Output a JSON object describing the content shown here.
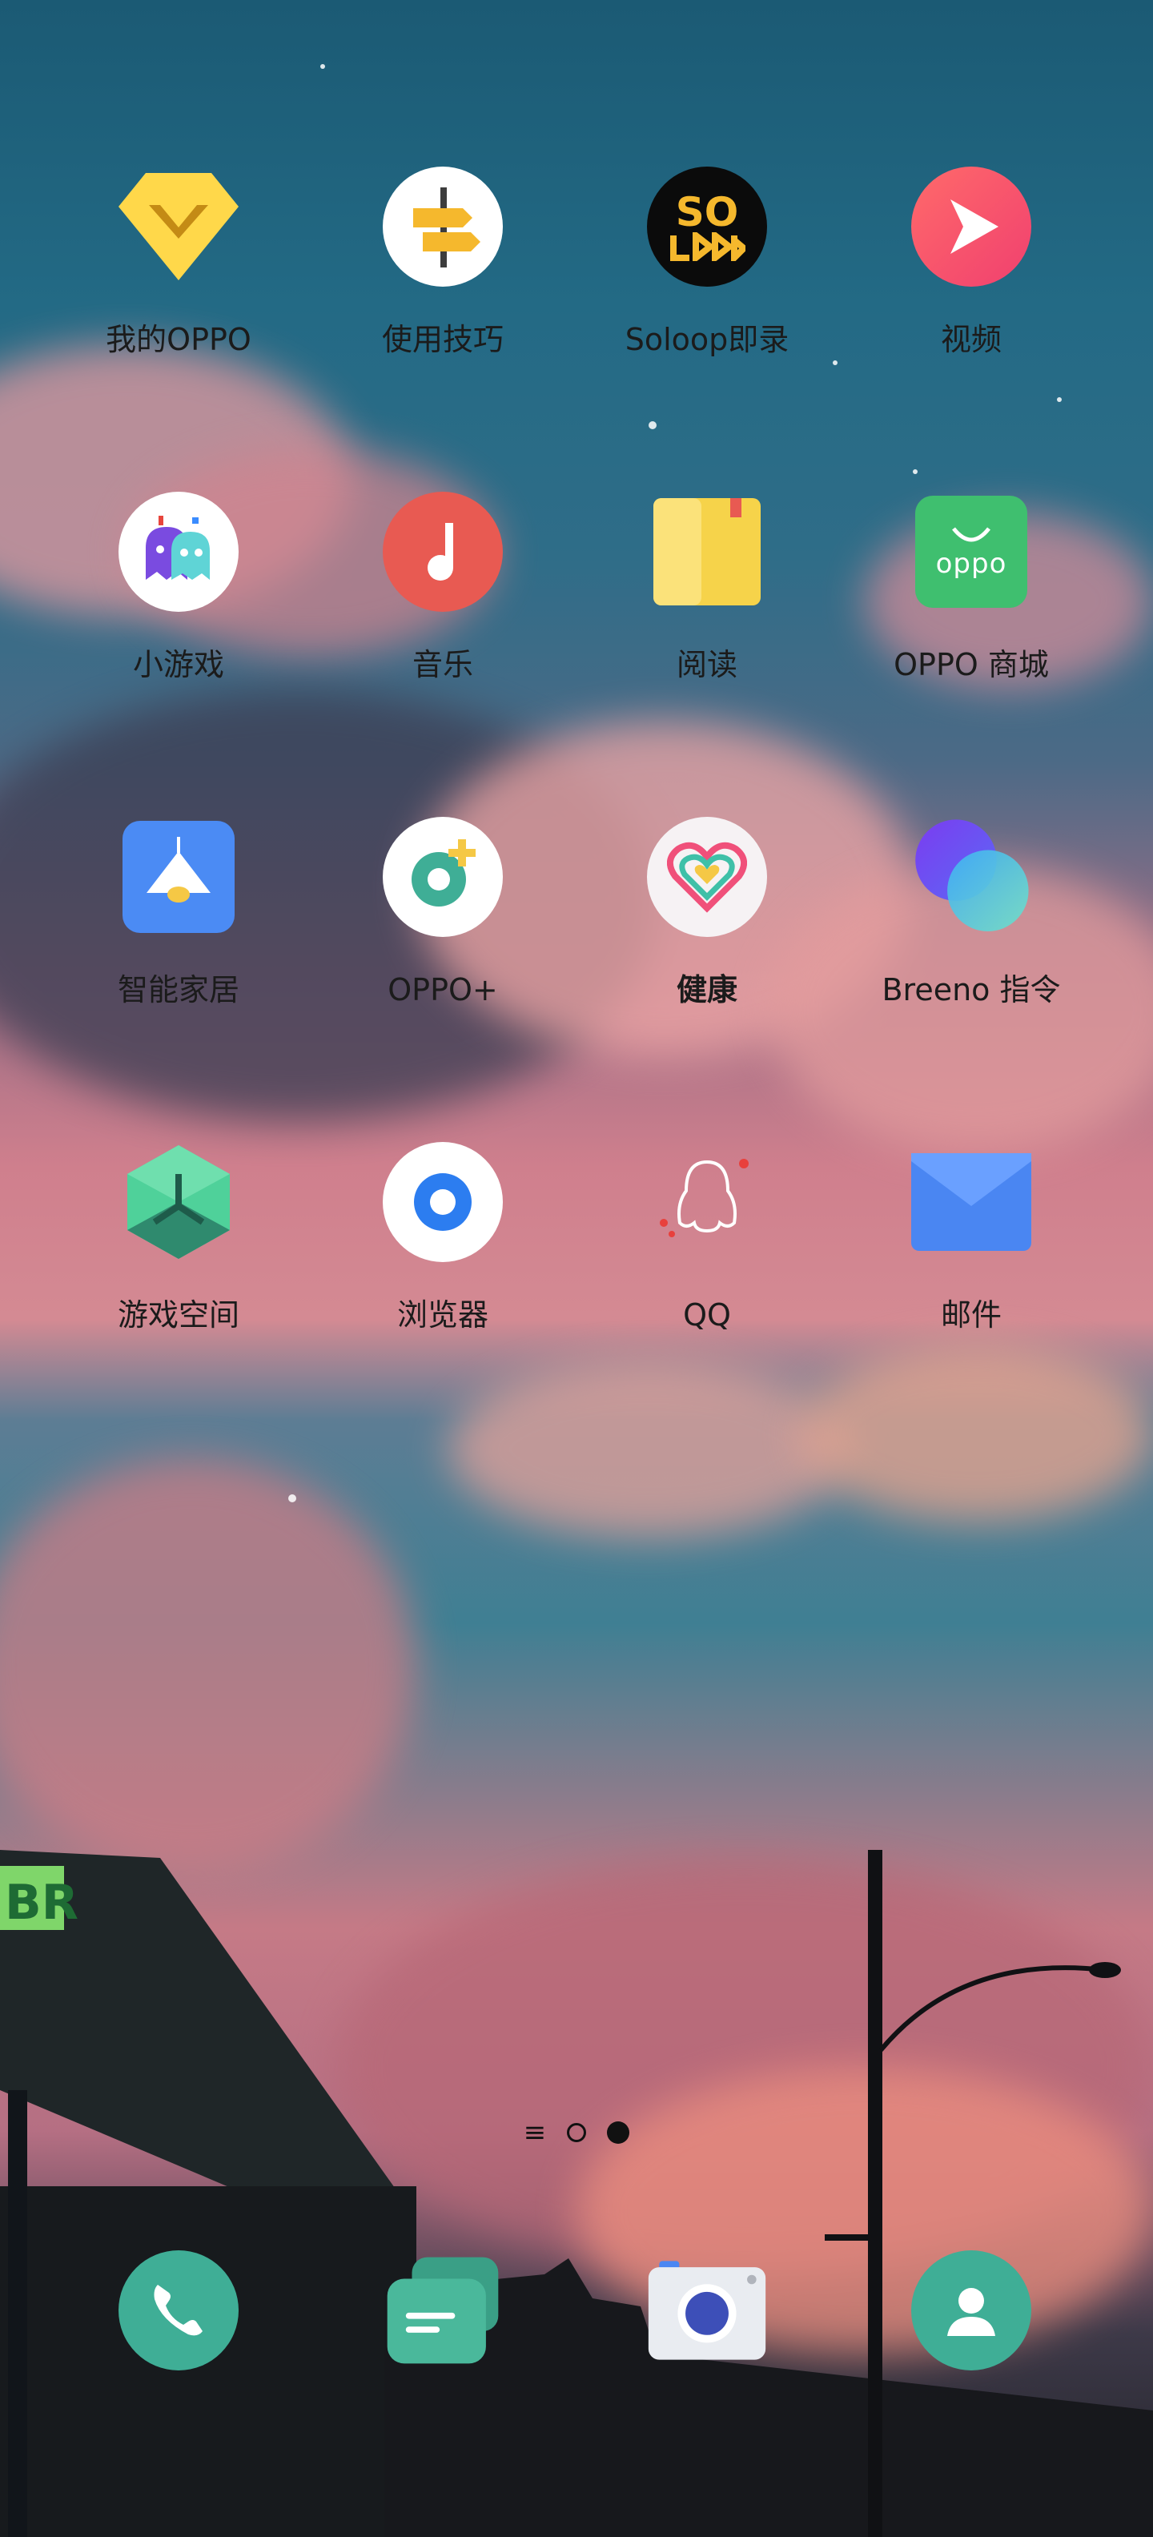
{
  "homescreen": {
    "rows": [
      [
        {
          "label": "我的OPPO",
          "icon": "my-oppo-diamond-icon"
        },
        {
          "label": "使用技巧",
          "icon": "signpost-icon"
        },
        {
          "label": "Soloop即录",
          "icon": "soloop-icon",
          "icon_text": "SO"
        },
        {
          "label": "视频",
          "icon": "video-play-icon"
        }
      ],
      [
        {
          "label": "小游戏",
          "icon": "ghosts-icon"
        },
        {
          "label": "音乐",
          "icon": "music-note-icon"
        },
        {
          "label": "阅读",
          "icon": "book-icon"
        },
        {
          "label": "OPPO 商城",
          "icon": "shopping-bag-icon",
          "icon_text": "oppo"
        }
      ],
      [
        {
          "label": "智能家居",
          "icon": "lamp-icon"
        },
        {
          "label": "OPPO+",
          "icon": "oppo-plus-icon"
        },
        {
          "label": "健康",
          "icon": "heart-icon"
        },
        {
          "label": "Breeno 指令",
          "icon": "breeno-circles-icon"
        }
      ],
      [
        {
          "label": "游戏空间",
          "icon": "game-hexagon-icon"
        },
        {
          "label": "浏览器",
          "icon": "browser-icon"
        },
        {
          "label": "QQ",
          "icon": "penguin-icon"
        },
        {
          "label": "邮件",
          "icon": "envelope-icon"
        }
      ]
    ],
    "page_indicator": {
      "menu_glyph": "≡",
      "pages": 2,
      "active_page": 2
    },
    "dock": [
      {
        "name": "phone",
        "icon": "phone-icon"
      },
      {
        "name": "messages",
        "icon": "message-bubble-icon"
      },
      {
        "name": "camera",
        "icon": "camera-icon"
      },
      {
        "name": "contacts",
        "icon": "contact-person-icon"
      }
    ],
    "wallpaper_sign_text": "BR",
    "colors": {
      "label": "#1b1b1b",
      "dock_teal": "#3fae96",
      "sky_top": "#1b5a74",
      "cloud_pink": "#d48a93"
    }
  }
}
